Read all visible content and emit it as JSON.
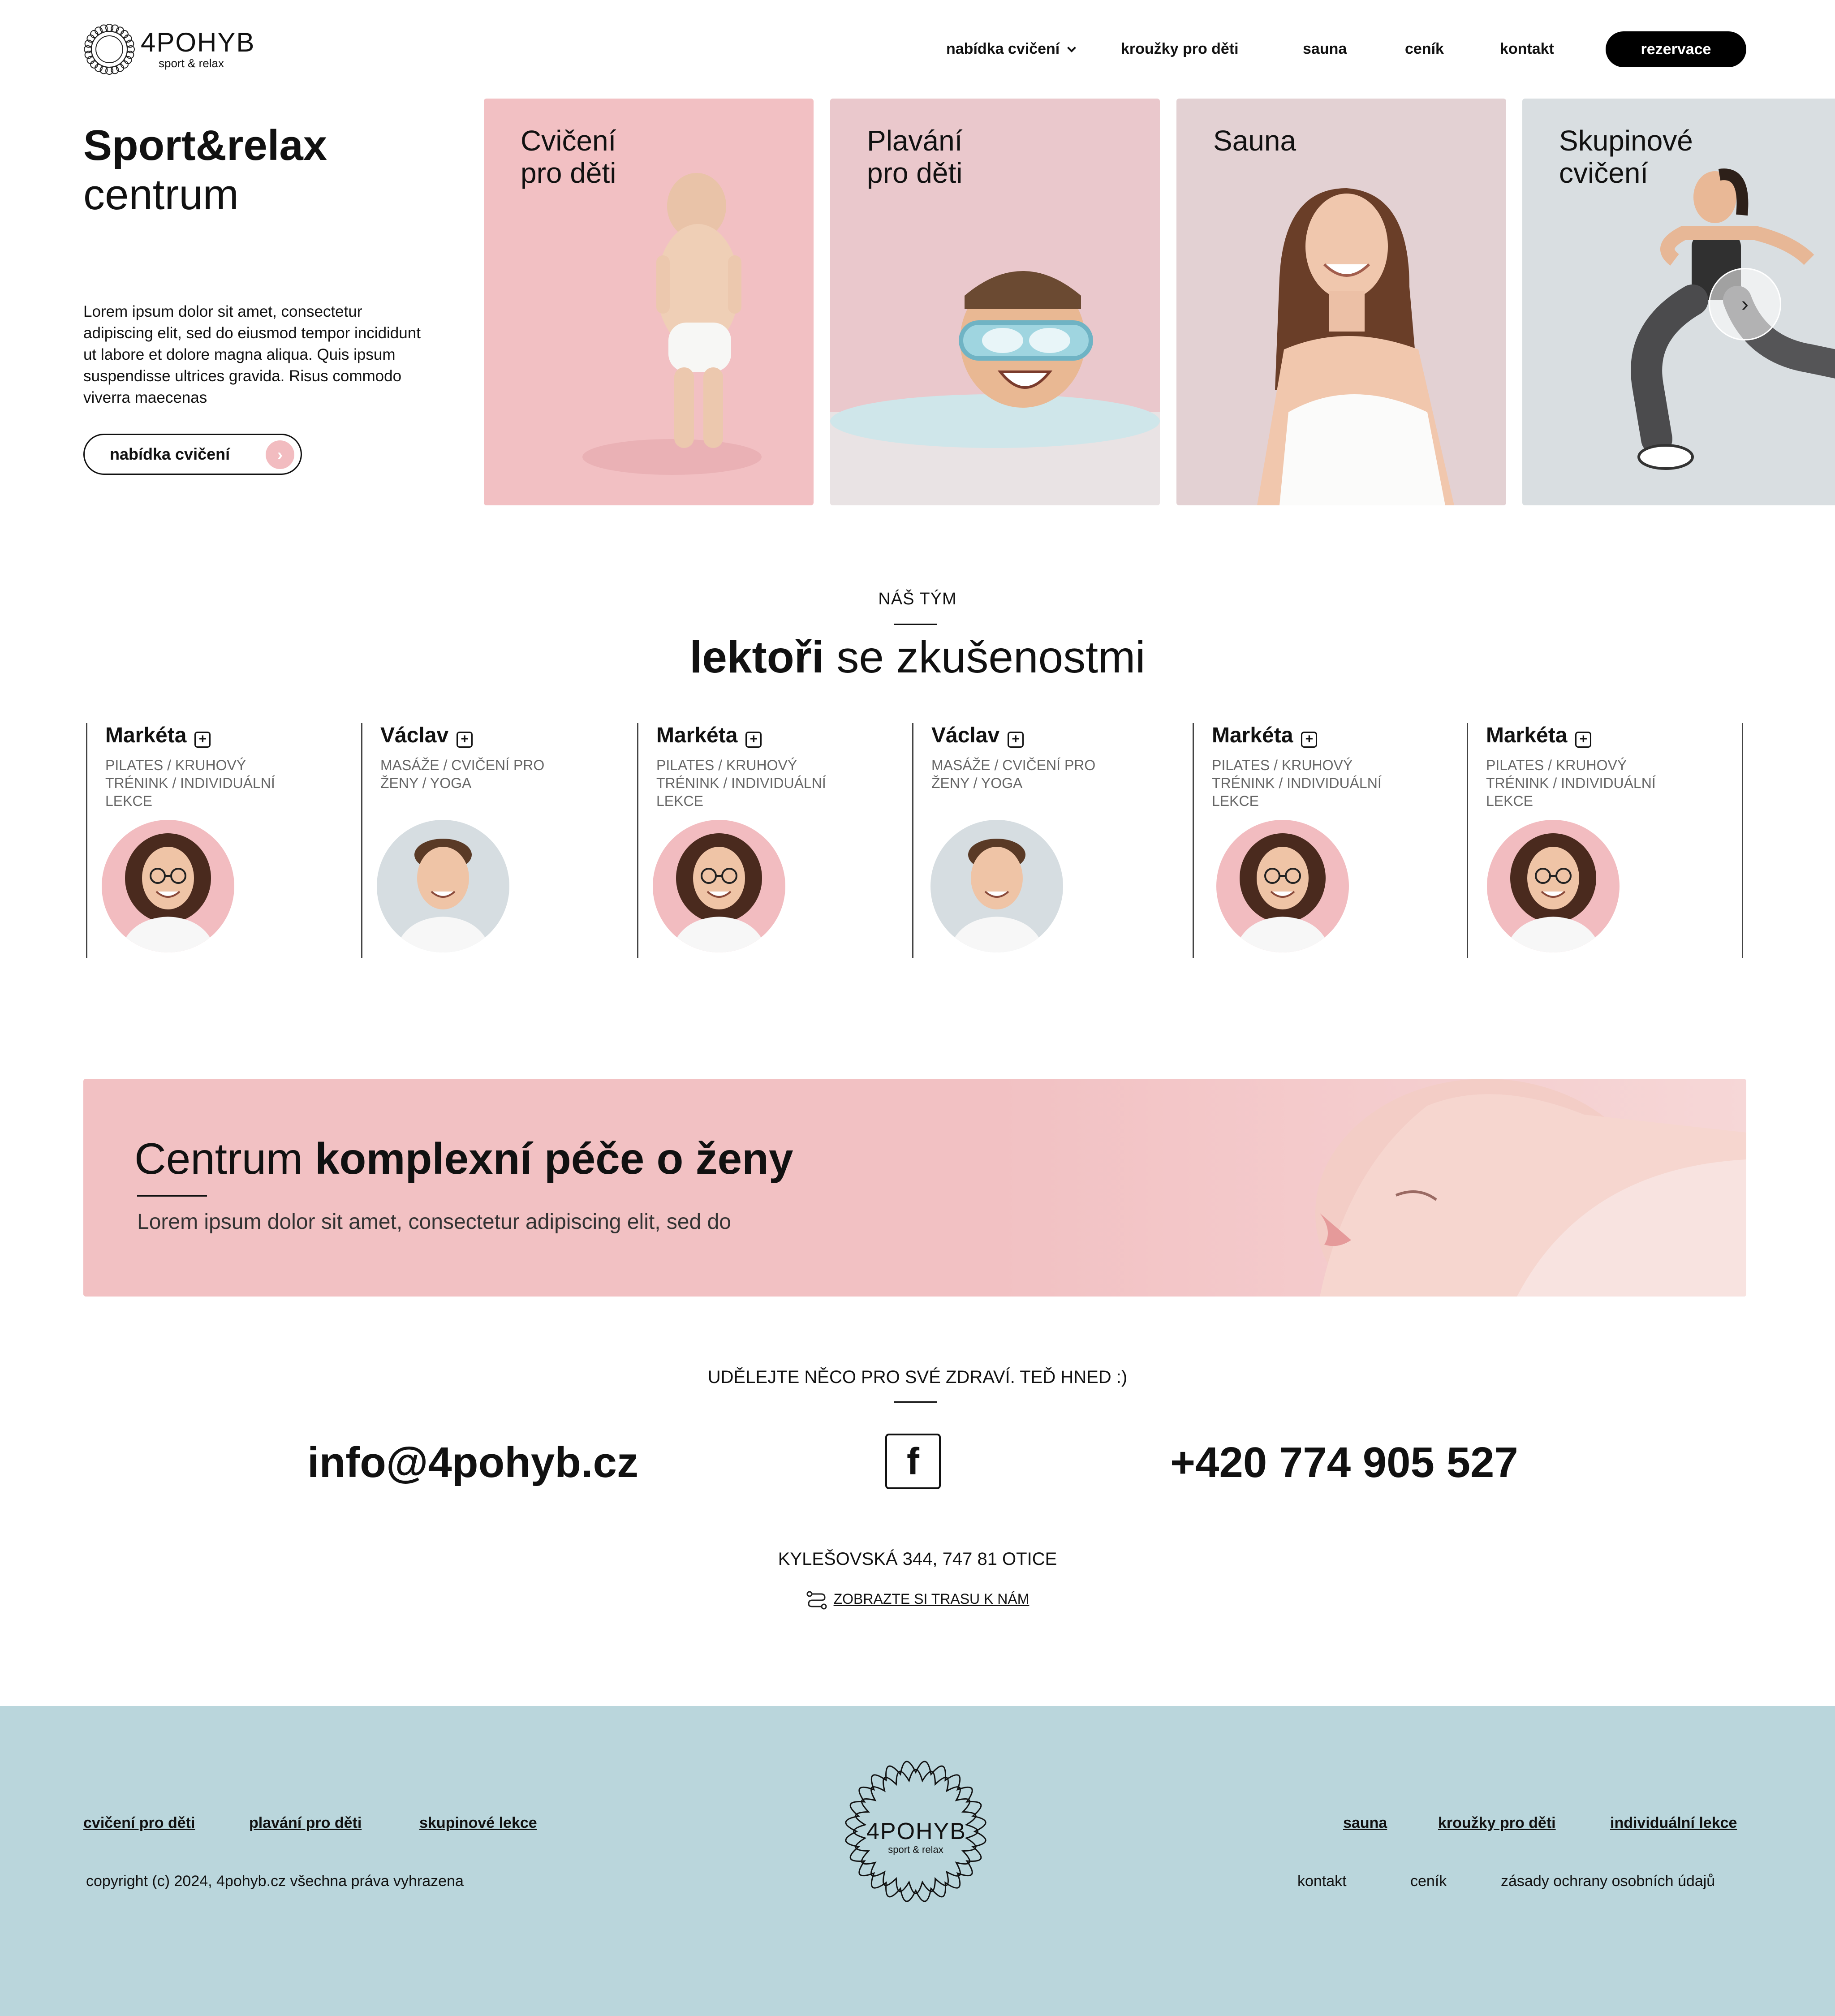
{
  "header": {
    "brand": "4POHYB",
    "tagline": "sport & relax",
    "nav": [
      {
        "label": "nabídka cvičení"
      },
      {
        "label": "kroužky pro děti"
      },
      {
        "label": "sauna"
      },
      {
        "label": "ceník"
      },
      {
        "label": "kontakt"
      }
    ],
    "cta_label": "rezervace"
  },
  "hero": {
    "title_bold": "Sport&relax",
    "title_rest": "centrum",
    "text": "Lorem ipsum dolor sit amet, consectetur adipiscing elit, sed do eiusmod tempor incididunt ut labore et dolore magna aliqua. Quis ipsum suspendisse ultrices gravida. Risus commodo viverra maecenas",
    "button_label": "nabídka cvičení"
  },
  "cards": [
    {
      "title": "Cvičení\npro děti",
      "bg": "#f2c0c3"
    },
    {
      "title": "Plavání\npro děti",
      "bg": "#eac8cc"
    },
    {
      "title": "Sauna",
      "bg": "#e3d1d3"
    },
    {
      "title": "Skupinové\ncvičení",
      "bg": "#d9dee1"
    }
  ],
  "team": {
    "eyebrow": "NÁŠ TÝM",
    "title_bold": "lektoři",
    "title_rest": "se zkušenostmi",
    "lectors": [
      {
        "name": "Markéta",
        "role": "PILATES / KRUHOVÝ TRÉNINK / INDIVIDUÁLNÍ LEKCE"
      },
      {
        "name": "Václav",
        "role": "MASÁŽE / CVIČENÍ PRO ŽENY / YOGA"
      },
      {
        "name": "Markéta",
        "role": "PILATES / KRUHOVÝ TRÉNINK / INDIVIDUÁLNÍ LEKCE"
      },
      {
        "name": "Václav",
        "role": "MASÁŽE / CVIČENÍ PRO ŽENY / YOGA"
      },
      {
        "name": "Markéta",
        "role": "PILATES / KRUHOVÝ TRÉNINK / INDIVIDUÁLNÍ LEKCE"
      },
      {
        "name": "Markéta",
        "role": "PILATES / KRUHOVÝ TRÉNINK / INDIVIDUÁLNÍ LEKCE"
      }
    ]
  },
  "banner": {
    "title_light": "Centrum",
    "title_bold": "komplexní péče o ženy",
    "text": "Lorem ipsum dolor sit amet, consectetur adipiscing elit, sed do"
  },
  "contact": {
    "cta": "UDĚLEJTE NĚCO PRO SVÉ ZDRAVÍ. TEĎ HNED :)",
    "email": "info@4pohyb.cz",
    "facebook_glyph": "f",
    "phone": "+420 774 905 527",
    "address": "KYLEŠOVSKÁ 344,  747 81 OTICE",
    "route_label": "ZOBRAZTE SI TRASU K NÁM"
  },
  "footer": {
    "left_links": [
      "cvičení pro děti",
      "plavání pro děti",
      "skupinové lekce"
    ],
    "right_links": [
      "sauna",
      "kroužky pro děti",
      "individuální lekce"
    ],
    "copyright": "copyright (c) 2024, 4pohyb.cz všechna práva vyhrazena",
    "bottom_links": [
      "kontakt",
      "ceník",
      "zásady ochrany osobních údajů"
    ],
    "brand": "4POHYB",
    "tagline": "sport & relax"
  },
  "colors": {
    "accent_pink": "#f2bcc0",
    "footer_bg": "#bad6dc",
    "button_dark": "#000000"
  }
}
